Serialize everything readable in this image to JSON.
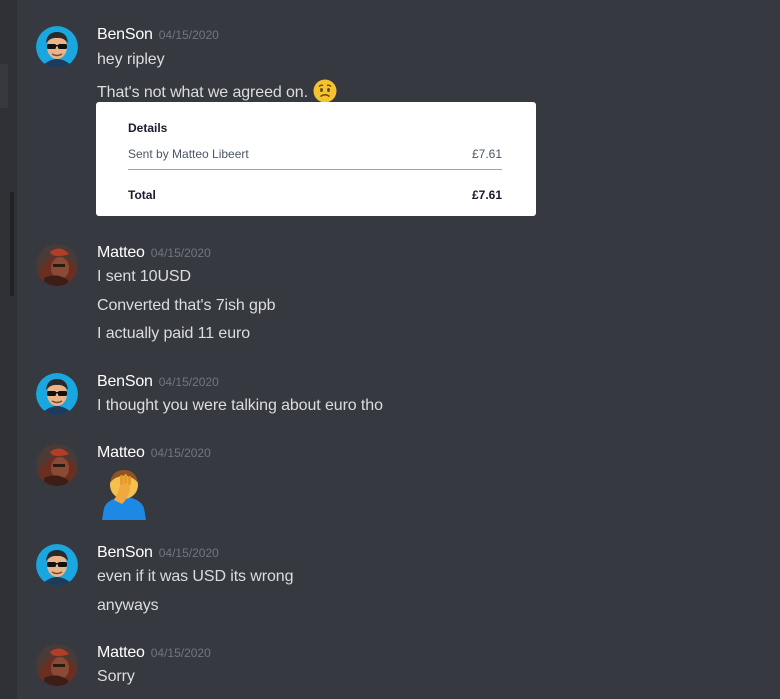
{
  "messages": [
    {
      "author": "BenSon",
      "timestamp": "04/15/2020",
      "avatar": "benson-avatar",
      "lines": [
        "hey ripley",
        "That's not what we agreed on."
      ],
      "emoji_line2": "worried-face-emoji",
      "embed": {
        "heading": "Details",
        "row_label": "Sent by Matteo Libeert",
        "row_amount": "£7.61",
        "total_label": "Total",
        "total_amount": "£7.61"
      }
    },
    {
      "author": "Matteo",
      "timestamp": "04/15/2020",
      "avatar": "matteo-avatar",
      "lines": [
        "I sent 10USD",
        "Converted that's 7ish gpb",
        "I actually paid 11 euro"
      ]
    },
    {
      "author": "BenSon",
      "timestamp": "04/15/2020",
      "avatar": "benson-avatar",
      "lines": [
        "I thought you were talking about euro tho"
      ]
    },
    {
      "author": "Matteo",
      "timestamp": "04/15/2020",
      "avatar": "matteo-avatar",
      "emoji": "facepalm-emoji"
    },
    {
      "author": "BenSon",
      "timestamp": "04/15/2020",
      "avatar": "benson-avatar",
      "lines": [
        "even if it was USD its wrong",
        "anyways"
      ]
    },
    {
      "author": "Matteo",
      "timestamp": "04/15/2020",
      "avatar": "matteo-avatar",
      "lines": [
        "Sorry"
      ]
    }
  ],
  "colors": {
    "background": "#36393f",
    "username": "#ffffff",
    "timestamp": "#72767d",
    "message_text": "#dcddde",
    "embed_background": "#ffffff"
  }
}
